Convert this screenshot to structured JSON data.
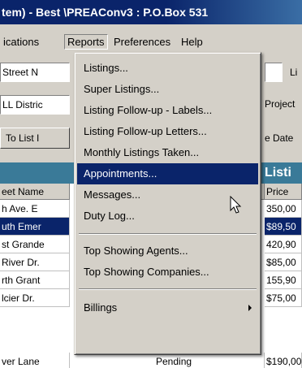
{
  "window": {
    "title": "tem) - Best \\PREAConv3 : P.O.Box 531"
  },
  "menubar": {
    "items": [
      "ications",
      "Reports",
      "Preferences",
      "Help"
    ]
  },
  "toolbar": {
    "street_field": "Street N",
    "li_field": "Li",
    "district_field": "LL Distric",
    "project_label": "Project",
    "to_list_button": "To List I",
    "date_label": "e Date"
  },
  "banner": {
    "title": "Listi"
  },
  "grid": {
    "headers": [
      "eet Name",
      "Price"
    ],
    "rows": [
      {
        "street": "h Ave. E",
        "price": "350,00"
      },
      {
        "street": "uth Emer",
        "price": "$89,50"
      },
      {
        "street": "st Grande",
        "price": "420,90"
      },
      {
        "street": "River Dr.",
        "price": "$85,00"
      },
      {
        "street": "rth Grant",
        "price": "155,90"
      },
      {
        "street": "lcier Dr.",
        "price": "$75,00"
      },
      {
        "street": "ver Lane",
        "status": "Pending",
        "price": "$190,00"
      }
    ]
  },
  "reports_menu": {
    "items": [
      "Listings...",
      "Super Listings...",
      "Listing Follow-up - Labels...",
      "Listing Follow-up Letters...",
      "Monthly Listings Taken...",
      "Appointments...",
      "Messages...",
      "Duty Log...",
      "Top Showing Agents...",
      "Top Showing Companies...",
      "Billings"
    ],
    "highlighted": "Appointments..."
  },
  "colors": {
    "title_bar": "#0a246a",
    "highlight": "#0a246a",
    "banner": "#3a7a98",
    "face": "#d4d0c8"
  }
}
